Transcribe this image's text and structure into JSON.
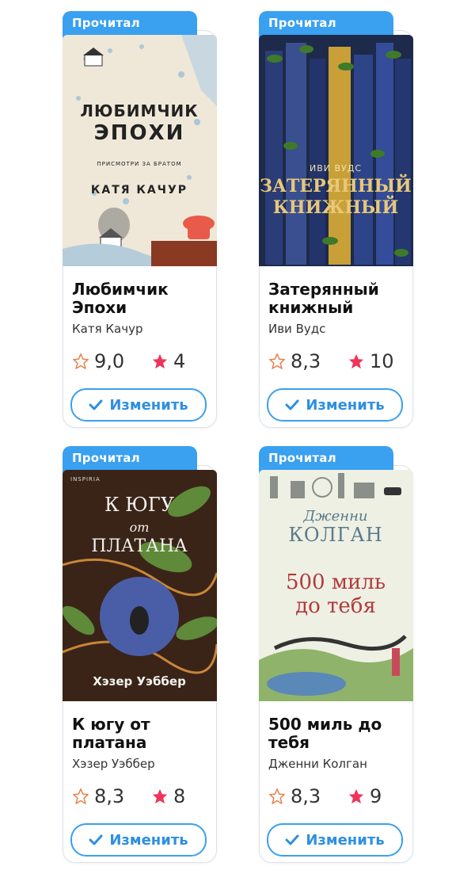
{
  "books": [
    {
      "status": "Прочитал",
      "title": "Любимчик Эпохи",
      "author": "Катя Качур",
      "rating": "9,0",
      "score": "4",
      "button": "Изменить",
      "cover": {
        "line1": "ЛЮБИМЧИК",
        "line2": "ЭПОХИ",
        "sub": "ПРИСМОТРИ ЗА БРАТОМ",
        "author": "КАТЯ КАЧУР"
      }
    },
    {
      "status": "Прочитал",
      "title": "Затерянный книжный",
      "author": "Иви Вудс",
      "rating": "8,3",
      "score": "10",
      "button": "Изменить",
      "cover": {
        "author": "ИВИ ВУДС",
        "line1": "ЗАТЕРЯННЫЙ",
        "line2": "КНИЖНЫЙ"
      }
    },
    {
      "status": "Прочитал",
      "title": "К югу от платана",
      "author": "Хэзер Уэббер",
      "rating": "8,3",
      "score": "8",
      "button": "Изменить",
      "cover": {
        "publisher": "INSPIRIA",
        "line1": "К ЮГУ",
        "line2": "от",
        "line3": "ПЛАТАНА",
        "author": "Хэзер Уэббер"
      }
    },
    {
      "status": "Прочитал",
      "title": "500 миль до тебя",
      "author": "Дженни Колган",
      "rating": "8,3",
      "score": "9",
      "button": "Изменить",
      "cover": {
        "author1": "Дженни",
        "author2": "КОЛГАН",
        "line1": "500 миль",
        "line2": "до тебя"
      }
    }
  ],
  "colors": {
    "accent": "#3aa0f0",
    "star": "#f0345a",
    "outline_star": "#e8804a"
  }
}
